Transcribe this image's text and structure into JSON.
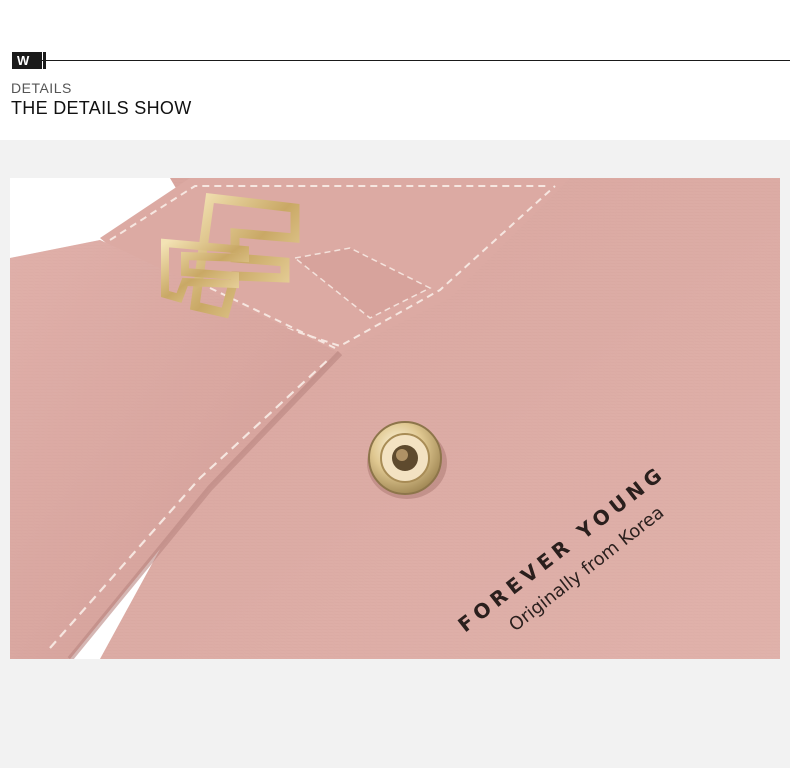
{
  "header": {
    "logo_letter": "W",
    "category_label": "DETAILS",
    "title": "THE DETAILS SHOW"
  },
  "photo": {
    "imprint_line_1": "FOREVER YOUNG",
    "imprint_line_2": "Originally from Korea",
    "colors": {
      "leather": "#d9a6a0",
      "leather_dark": "#b98580",
      "gold": "#d8c089",
      "background": "#f2f2f2"
    }
  }
}
